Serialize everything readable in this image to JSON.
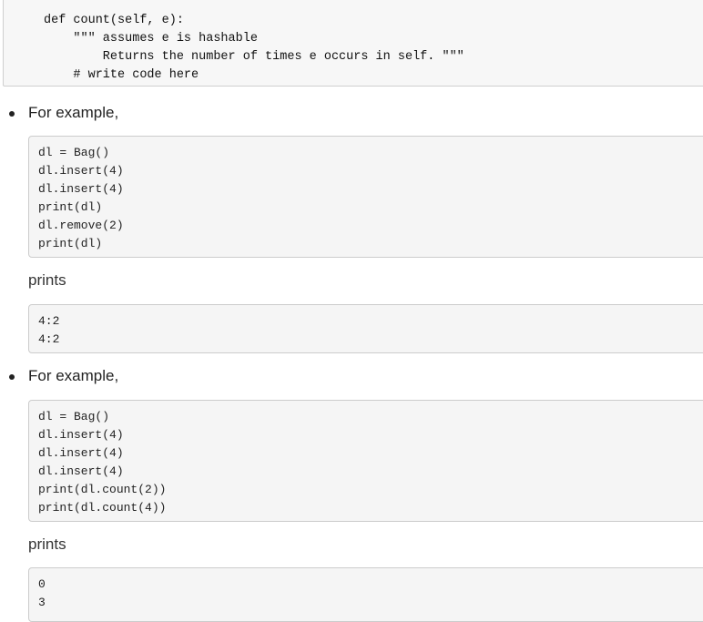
{
  "method_block": {
    "lines": [
      "def count(self, e):",
      "    \"\"\" assumes e is hashable",
      "        Returns the number of times e occurs in self. \"\"\"",
      "    # write code here"
    ]
  },
  "examples": [
    {
      "intro": "For example,",
      "code": "dl = Bag()\ndl.insert(4)\ndl.insert(4)\nprint(dl)\ndl.remove(2)\nprint(dl)",
      "prints_label": "prints",
      "output": "4:2\n4:2"
    },
    {
      "intro": "For example,",
      "code": "dl = Bag()\ndl.insert(4)\ndl.insert(4)\ndl.insert(4)\nprint(dl.count(2))\nprint(dl.count(4))",
      "prints_label": "prints",
      "output": "0\n3"
    }
  ]
}
